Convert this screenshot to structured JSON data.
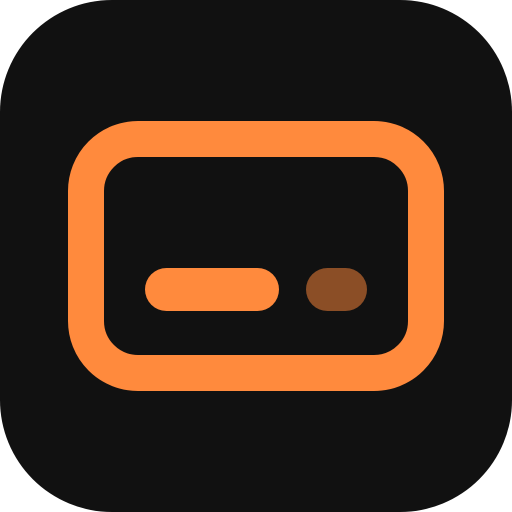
{
  "icon": {
    "name": "card-terminal-app-icon",
    "colors": {
      "tile": "#111111",
      "accent": "#FF8A3D",
      "dot": "#8B4E26"
    }
  }
}
